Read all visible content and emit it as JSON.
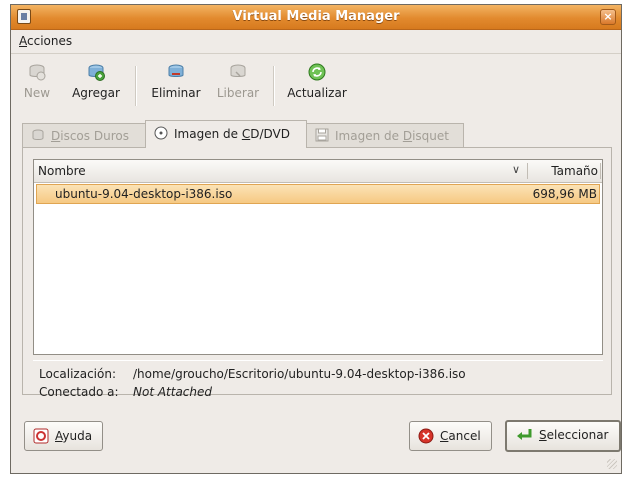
{
  "window": {
    "title": "Virtual Media Manager",
    "close_glyph": "×"
  },
  "menubar": {
    "items": [
      {
        "label": "Acciones",
        "accel": "A",
        "rest": "cciones"
      }
    ]
  },
  "toolbar": {
    "buttons": [
      {
        "label": "New",
        "icon": "disk-new-icon",
        "enabled": false
      },
      {
        "label": "Agregar",
        "icon": "disk-add-icon",
        "enabled": true
      },
      {
        "label": "Eliminar",
        "icon": "disk-remove-icon",
        "enabled": true
      },
      {
        "label": "Liberar",
        "icon": "disk-release-icon",
        "enabled": false
      },
      {
        "label": "Actualizar",
        "icon": "refresh-icon",
        "enabled": true
      }
    ]
  },
  "tabs": [
    {
      "pre": "",
      "accel": "D",
      "rest": "iscos Duros",
      "icon": "hard-disk-icon",
      "active": false,
      "enabled": false
    },
    {
      "pre": "Imagen de ",
      "accel": "C",
      "rest": "D/DVD",
      "icon": "cd-dvd-icon",
      "active": true,
      "enabled": true
    },
    {
      "pre": "Imagen de ",
      "accel": "D",
      "rest": "isquet",
      "icon": "floppy-icon",
      "active": false,
      "enabled": false
    }
  ],
  "list": {
    "columns": {
      "name": "Nombre",
      "size": "Tamaño"
    },
    "rows": [
      {
        "name": "ubuntu-9.04-desktop-i386.iso",
        "size": "698,96 MB",
        "selected": true
      }
    ]
  },
  "info": {
    "location_label": "Localización:",
    "location_value": "/home/groucho/Escritorio/ubuntu-9.04-desktop-i386.iso",
    "attached_label": "Conectado a:",
    "attached_value": "Not Attached"
  },
  "buttons": {
    "help": {
      "accel": "A",
      "rest": "yuda"
    },
    "cancel": {
      "accel": "C",
      "rest": "ancel"
    },
    "select": {
      "accel": "S",
      "rest": "eleccionar"
    }
  },
  "colors": {
    "title_bar": "#e28a2e",
    "selection": "#f6c983",
    "background": "#efebe7"
  }
}
